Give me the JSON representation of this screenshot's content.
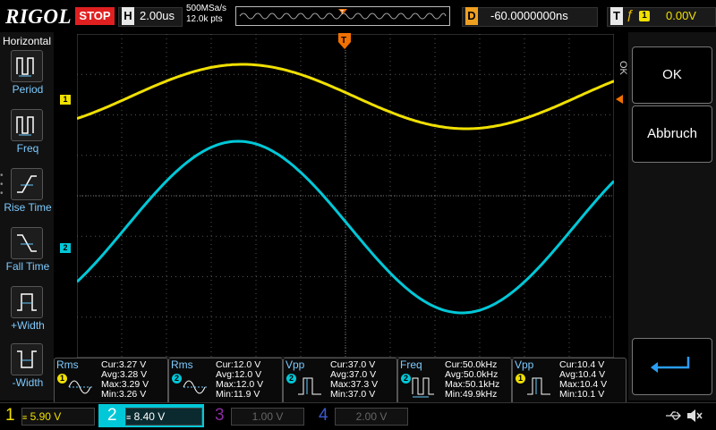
{
  "header": {
    "logo": "RIGOL",
    "run_status": "STOP",
    "timebase_label": "H",
    "timebase_value": "2.00us",
    "sample_rate": "500MSa/s",
    "memory_depth": "12.0k pts",
    "delay_label": "D",
    "delay_value": "-60.0000000ns",
    "trigger_label": "T",
    "trigger_source": "1",
    "trigger_level": "0.00V"
  },
  "left_menu": {
    "title": "Horizontal",
    "items": [
      {
        "label": "Period",
        "icon": "period-icon"
      },
      {
        "label": "Freq",
        "icon": "frequency-icon"
      },
      {
        "label": "Rise Time",
        "icon": "rise-time-icon"
      },
      {
        "label": "Fall Time",
        "icon": "fall-time-icon"
      },
      {
        "label": "+Width",
        "icon": "positive-width-icon"
      },
      {
        "label": "-Width",
        "icon": "negative-width-icon"
      }
    ]
  },
  "right_menu": {
    "side_label": "OK",
    "ok_label": "OK",
    "cancel_label": "Abbruch",
    "back_icon": "return-arrow-icon"
  },
  "channels": [
    {
      "num": "1",
      "scale": "5.90 V",
      "color": "#f0e000",
      "marker": "1"
    },
    {
      "num": "2",
      "scale": "8.40 V",
      "color": "#00c8d8",
      "marker": "2"
    },
    {
      "num": "3",
      "scale": "1.00 V",
      "color": "#8a2ca0"
    },
    {
      "num": "4",
      "scale": "2.00 V",
      "color": "#3a5ad0"
    }
  ],
  "measurements": [
    {
      "name": "Rms",
      "channel": "1",
      "icon": "rms-wave-icon",
      "cur": "Cur:3.27 V",
      "avg": "Avg:3.28 V",
      "max": "Max:3.29 V",
      "min": "Min:3.26 V"
    },
    {
      "name": "Rms",
      "channel": "2",
      "icon": "rms-wave-icon",
      "cur": "Cur:12.0 V",
      "avg": "Avg:12.0 V",
      "max": "Max:12.0 V",
      "min": "Min:11.9 V"
    },
    {
      "name": "Vpp",
      "channel": "2",
      "icon": "vpp-pulse-icon",
      "cur": "Cur:37.0 V",
      "avg": "Avg:37.0 V",
      "max": "Max:37.3 V",
      "min": "Min:37.0 V"
    },
    {
      "name": "Freq",
      "channel": "2",
      "icon": "freq-pulse-icon",
      "cur": "Cur:50.0kHz",
      "avg": "Avg:50.0kHz",
      "max": "Max:50.1kHz",
      "min": "Min:49.9kHz"
    },
    {
      "name": "Vpp",
      "channel": "1",
      "icon": "vpp-pulse-icon",
      "cur": "Cur:10.4 V",
      "avg": "Avg:10.4 V",
      "max": "Max:10.4 V",
      "min": "Min:10.1 V"
    }
  ],
  "status_icons": [
    "usb-icon",
    "speaker-muted-icon"
  ]
}
